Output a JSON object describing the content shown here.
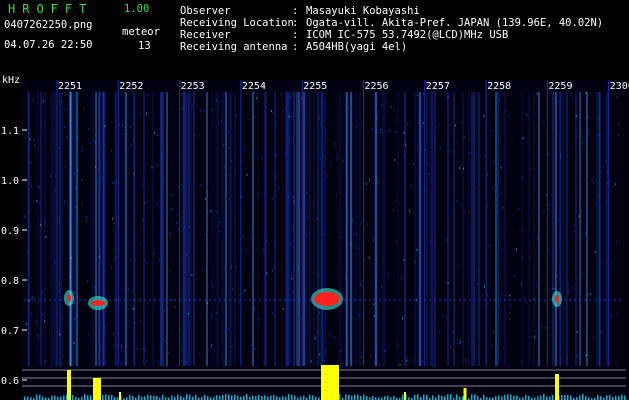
{
  "header": {
    "app_name": "HROFFT",
    "version": "1.00",
    "file_name": "0407262250.png",
    "timestamp": "04.07.26 22:50",
    "meteor_label": "meteor",
    "meteor_count": "13"
  },
  "info": [
    {
      "key": "Observer",
      "sep": ":",
      "value": "Masayuki Kobayashi"
    },
    {
      "key": "Receiving Location",
      "sep": ":",
      "value": "Ogata-vill. Akita-Pref. JAPAN (139.96E, 40.02N)"
    },
    {
      "key": "Receiver",
      "sep": ":",
      "value": "ICOM IC-575 53.7492(@LCD)MHz USB"
    },
    {
      "key": "Receiving antenna",
      "sep": ":",
      "value": "A504HB(yagi 4el)"
    }
  ],
  "spectrogram": {
    "y_unit": "kHz",
    "y_ticks": [
      "1.1",
      "1.0",
      "0.9",
      "0.8",
      "0.7",
      "0.6"
    ],
    "time_labels": [
      "2251",
      "2252",
      "2253",
      "2254",
      "2255",
      "2256",
      "2257",
      "2258",
      "2259",
      "2300"
    ],
    "colors": {
      "bg": "#000010",
      "signal": "#1565ff",
      "meteor_core": "#ff2020",
      "meteor_halo": "#40ffe0",
      "activity": "#ffff00",
      "baseline": "#00e0ff",
      "grid": "#ffffff"
    }
  }
}
